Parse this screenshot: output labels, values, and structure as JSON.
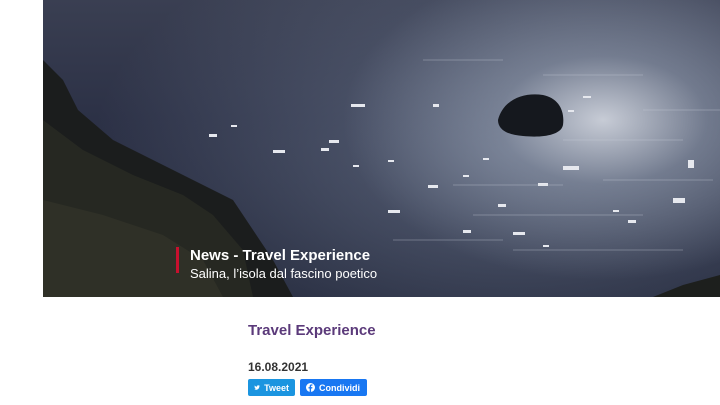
{
  "hero": {
    "category": "News - Travel Experience",
    "headline": "Salina, l’isola dal fascino poetico"
  },
  "article": {
    "section": "Travel Experience",
    "date": "16.08.2021"
  },
  "share": {
    "tweet_label": "Tweet",
    "share_label": "Condividi"
  },
  "colors": {
    "accent_bar": "#c8102e",
    "section_title": "#5b3a7a",
    "twitter": "#1b95e0",
    "facebook": "#1877f2"
  }
}
